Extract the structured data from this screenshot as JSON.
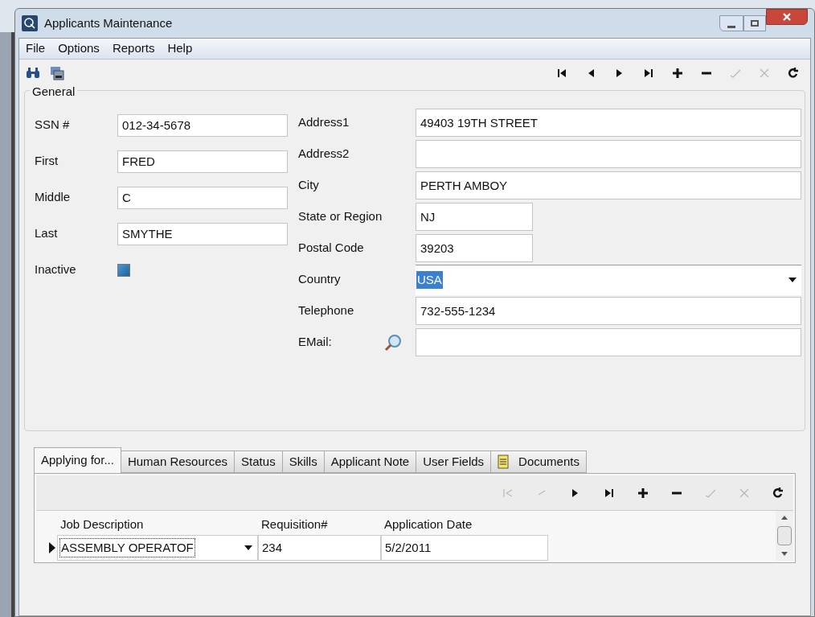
{
  "window": {
    "title": "Applicants Maintenance"
  },
  "menu": [
    "File",
    "Options",
    "Reports",
    "Help"
  ],
  "toolbar": {
    "left": [
      {
        "kind": "find"
      },
      {
        "kind": "form"
      }
    ],
    "nav": [
      {
        "kind": "first",
        "disabled": false
      },
      {
        "kind": "prev",
        "disabled": false
      },
      {
        "kind": "next",
        "disabled": false
      },
      {
        "kind": "last",
        "disabled": false
      },
      {
        "kind": "add",
        "disabled": false
      },
      {
        "kind": "remove",
        "disabled": false
      },
      {
        "kind": "post",
        "disabled": true
      },
      {
        "kind": "cancel",
        "disabled": true
      },
      {
        "kind": "refresh",
        "disabled": false
      }
    ]
  },
  "general": {
    "title": "General",
    "left_fields": [
      {
        "label": "SSN #",
        "value": "012-34-5678"
      },
      {
        "label": "First",
        "value": "FRED"
      },
      {
        "label": "Middle",
        "value": "C"
      },
      {
        "label": "Last",
        "value": "SMYTHE"
      }
    ],
    "inactive": {
      "label": "Inactive",
      "checked": true
    },
    "right_fields": [
      {
        "kind": "text",
        "label": "Address1",
        "value": "49403 19TH STREET"
      },
      {
        "kind": "text",
        "label": "Address2"
      },
      {
        "kind": "text",
        "label": "City",
        "value": "PERTH AMBOY"
      },
      {
        "kind": "short",
        "label": "State or Region",
        "value": "NJ"
      },
      {
        "kind": "short",
        "label": "Postal Code",
        "value": "39203"
      },
      {
        "kind": "combo",
        "label": "Country",
        "value": "USA",
        "text_selected": true
      },
      {
        "kind": "text",
        "label": "Telephone",
        "value": "732-555-1234"
      },
      {
        "kind": "email",
        "label": "EMail:"
      }
    ]
  },
  "tabs": [
    {
      "label": "Applying for...",
      "selected": true
    },
    {
      "label": "Human Resources",
      "selected": false
    },
    {
      "label": "Status",
      "selected": false
    },
    {
      "label": "Skills",
      "selected": false
    },
    {
      "label": "Applicant Note",
      "selected": false
    },
    {
      "label": "User Fields",
      "selected": false
    },
    {
      "label": "Documents",
      "selected": false,
      "kind": "document"
    }
  ],
  "sub_toolbar": [
    {
      "kind": "first",
      "disabled": true
    },
    {
      "kind": "prev",
      "disabled": true
    },
    {
      "kind": "next",
      "disabled": false
    },
    {
      "kind": "last",
      "disabled": false
    },
    {
      "kind": "add",
      "disabled": false
    },
    {
      "kind": "remove",
      "disabled": false
    },
    {
      "kind": "post",
      "disabled": true
    },
    {
      "kind": "cancel",
      "disabled": true
    },
    {
      "kind": "refresh",
      "disabled": false
    }
  ],
  "grid": {
    "columns": [
      "Job Description",
      "Requisition#",
      "Application Date"
    ],
    "rows": [
      {
        "selected": true,
        "cells": [
          "ASSEMBLY OPERATOF",
          "234",
          "5/2/2011"
        ]
      }
    ]
  }
}
